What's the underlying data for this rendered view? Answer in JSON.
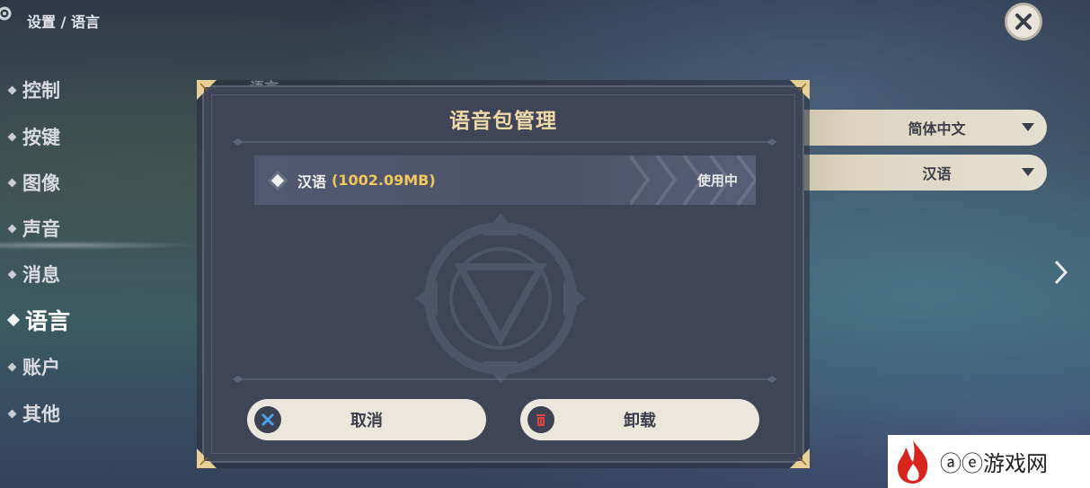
{
  "header": {
    "breadcrumb": "设置 / 语言"
  },
  "sidebar": {
    "items": [
      {
        "label": "控制"
      },
      {
        "label": "按键"
      },
      {
        "label": "图像"
      },
      {
        "label": "声音"
      },
      {
        "label": "消息"
      },
      {
        "label": "语言",
        "active": true
      },
      {
        "label": "账户"
      },
      {
        "label": "其他"
      }
    ]
  },
  "background_settings": {
    "section_label_partial": "语言",
    "text_language": "简体中文",
    "voice_language": "汉语"
  },
  "modal": {
    "title": "语音包管理",
    "packs": [
      {
        "name": "汉语",
        "size": "(1002.09MB)",
        "status": "使用中"
      }
    ],
    "cancel_label": "取消",
    "uninstall_label": "卸载"
  },
  "watermark": {
    "text": "ⓐⓔ游戏网"
  },
  "colors": {
    "accent_gold": "#edd9a8",
    "size_yellow": "#f2c75c",
    "modal_bg": "#3f4457",
    "button_bg": "#ece7dc"
  }
}
